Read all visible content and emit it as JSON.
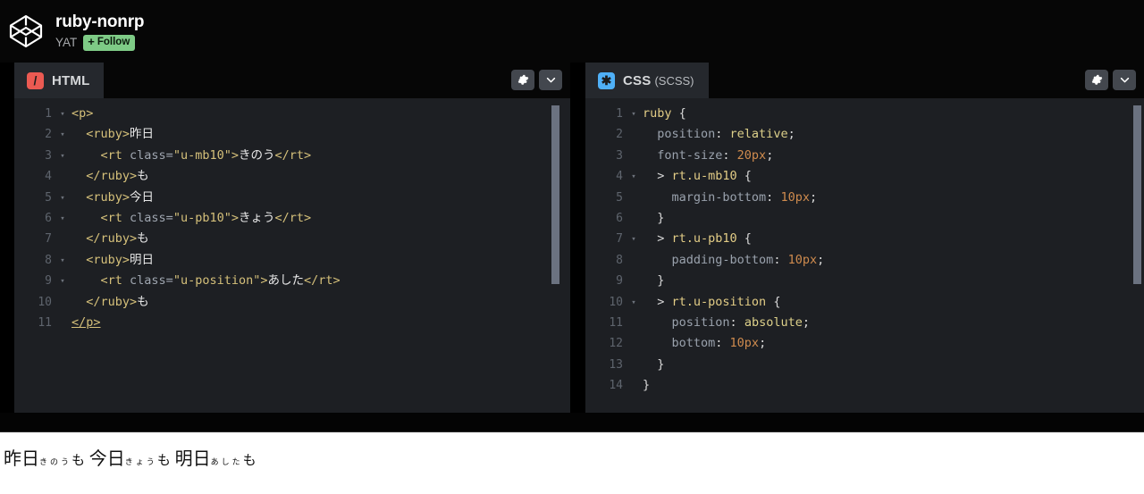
{
  "header": {
    "logo_icon": "codepen-logo-icon",
    "pen_title": "ruby-nonrp",
    "author": "YAT",
    "follow_plus": "+",
    "follow_label": "Follow"
  },
  "editors": {
    "html_pane": {
      "lang_icon": "html-slash-icon",
      "lang_icon_glyph": "/",
      "tab_label": "HTML",
      "settings_icon": "gear-icon",
      "collapse_icon": "chevron-down-icon",
      "lines": [
        {
          "n": "1",
          "fold": "▾",
          "segments": [
            {
              "c": "tag",
              "t": "<p>"
            }
          ]
        },
        {
          "n": "2",
          "fold": "▾",
          "segments": [
            {
              "c": "plain",
              "t": "  "
            },
            {
              "c": "tag",
              "t": "<ruby>"
            },
            {
              "c": "plain",
              "t": "昨日"
            }
          ]
        },
        {
          "n": "3",
          "fold": "▾",
          "segments": [
            {
              "c": "plain",
              "t": "    "
            },
            {
              "c": "tag",
              "t": "<rt "
            },
            {
              "c": "attr",
              "t": "class="
            },
            {
              "c": "str",
              "t": "\"u-mb10\""
            },
            {
              "c": "tag",
              "t": ">"
            },
            {
              "c": "plain",
              "t": "きのう"
            },
            {
              "c": "tag",
              "t": "</rt>"
            }
          ]
        },
        {
          "n": "4",
          "fold": "",
          "segments": [
            {
              "c": "plain",
              "t": "  "
            },
            {
              "c": "tag",
              "t": "</ruby>"
            },
            {
              "c": "plain",
              "t": "も"
            }
          ]
        },
        {
          "n": "5",
          "fold": "▾",
          "segments": [
            {
              "c": "plain",
              "t": "  "
            },
            {
              "c": "tag",
              "t": "<ruby>"
            },
            {
              "c": "plain",
              "t": "今日"
            }
          ]
        },
        {
          "n": "6",
          "fold": "▾",
          "segments": [
            {
              "c": "plain",
              "t": "    "
            },
            {
              "c": "tag",
              "t": "<rt "
            },
            {
              "c": "attr",
              "t": "class="
            },
            {
              "c": "str",
              "t": "\"u-pb10\""
            },
            {
              "c": "tag",
              "t": ">"
            },
            {
              "c": "plain",
              "t": "きょう"
            },
            {
              "c": "tag",
              "t": "</rt>"
            }
          ]
        },
        {
          "n": "7",
          "fold": "",
          "segments": [
            {
              "c": "plain",
              "t": "  "
            },
            {
              "c": "tag",
              "t": "</ruby>"
            },
            {
              "c": "plain",
              "t": "も"
            }
          ]
        },
        {
          "n": "8",
          "fold": "▾",
          "segments": [
            {
              "c": "plain",
              "t": "  "
            },
            {
              "c": "tag",
              "t": "<ruby>"
            },
            {
              "c": "plain",
              "t": "明日"
            }
          ]
        },
        {
          "n": "9",
          "fold": "▾",
          "segments": [
            {
              "c": "plain",
              "t": "    "
            },
            {
              "c": "tag",
              "t": "<rt "
            },
            {
              "c": "attr",
              "t": "class="
            },
            {
              "c": "str",
              "t": "\"u-position\""
            },
            {
              "c": "tag",
              "t": ">"
            },
            {
              "c": "plain",
              "t": "あした"
            },
            {
              "c": "tag",
              "t": "</rt>"
            }
          ]
        },
        {
          "n": "10",
          "fold": "",
          "segments": [
            {
              "c": "plain",
              "t": "  "
            },
            {
              "c": "tag",
              "t": "</ruby>"
            },
            {
              "c": "plain",
              "t": "も"
            }
          ]
        },
        {
          "n": "11",
          "fold": "",
          "segments": [
            {
              "c": "match",
              "t": "</p>"
            }
          ]
        }
      ]
    },
    "css_pane": {
      "lang_icon": "css-asterisk-icon",
      "lang_icon_glyph": "✱",
      "tab_label": "CSS",
      "tab_sublabel": "(SCSS)",
      "settings_icon": "gear-icon",
      "collapse_icon": "chevron-down-icon",
      "lines": [
        {
          "n": "1",
          "fold": "▾",
          "segments": [
            {
              "c": "sel",
              "t": "ruby"
            },
            {
              "c": "punc",
              "t": " {"
            }
          ]
        },
        {
          "n": "2",
          "fold": "",
          "segments": [
            {
              "c": "prop",
              "t": "  position"
            },
            {
              "c": "punc",
              "t": ": "
            },
            {
              "c": "val",
              "t": "relative"
            },
            {
              "c": "punc",
              "t": ";"
            }
          ]
        },
        {
          "n": "3",
          "fold": "",
          "segments": [
            {
              "c": "prop",
              "t": "  font-size"
            },
            {
              "c": "punc",
              "t": ": "
            },
            {
              "c": "num",
              "t": "20px"
            },
            {
              "c": "punc",
              "t": ";"
            }
          ]
        },
        {
          "n": "4",
          "fold": "▾",
          "segments": [
            {
              "c": "punc",
              "t": "  > "
            },
            {
              "c": "sel",
              "t": "rt.u-mb10"
            },
            {
              "c": "punc",
              "t": " {"
            }
          ]
        },
        {
          "n": "5",
          "fold": "",
          "segments": [
            {
              "c": "prop",
              "t": "    margin-bottom"
            },
            {
              "c": "punc",
              "t": ": "
            },
            {
              "c": "num",
              "t": "10px"
            },
            {
              "c": "punc",
              "t": ";"
            }
          ]
        },
        {
          "n": "6",
          "fold": "",
          "segments": [
            {
              "c": "punc",
              "t": "  }"
            }
          ]
        },
        {
          "n": "7",
          "fold": "▾",
          "segments": [
            {
              "c": "punc",
              "t": "  > "
            },
            {
              "c": "sel",
              "t": "rt.u-pb10"
            },
            {
              "c": "punc",
              "t": " {"
            }
          ]
        },
        {
          "n": "8",
          "fold": "",
          "segments": [
            {
              "c": "prop",
              "t": "    padding-bottom"
            },
            {
              "c": "punc",
              "t": ": "
            },
            {
              "c": "num",
              "t": "10px"
            },
            {
              "c": "punc",
              "t": ";"
            }
          ]
        },
        {
          "n": "9",
          "fold": "",
          "segments": [
            {
              "c": "punc",
              "t": "  }"
            }
          ]
        },
        {
          "n": "10",
          "fold": "▾",
          "segments": [
            {
              "c": "punc",
              "t": "  > "
            },
            {
              "c": "sel",
              "t": "rt.u-position"
            },
            {
              "c": "punc",
              "t": " {"
            }
          ]
        },
        {
          "n": "11",
          "fold": "",
          "segments": [
            {
              "c": "prop",
              "t": "    position"
            },
            {
              "c": "punc",
              "t": ": "
            },
            {
              "c": "val",
              "t": "absolute"
            },
            {
              "c": "punc",
              "t": ";"
            }
          ]
        },
        {
          "n": "12",
          "fold": "",
          "segments": [
            {
              "c": "prop",
              "t": "    bottom"
            },
            {
              "c": "punc",
              "t": ": "
            },
            {
              "c": "num",
              "t": "10px"
            },
            {
              "c": "punc",
              "t": ";"
            }
          ]
        },
        {
          "n": "13",
          "fold": "",
          "segments": [
            {
              "c": "punc",
              "t": "  }"
            }
          ]
        },
        {
          "n": "14",
          "fold": "",
          "segments": [
            {
              "c": "punc",
              "t": "}"
            }
          ]
        }
      ]
    }
  },
  "preview": {
    "groups": [
      {
        "base": "昨日",
        "ruby": "きのう",
        "cls": "u-mb10",
        "after": "も"
      },
      {
        "base": "今日",
        "ruby": "きょう",
        "cls": "u-pb10",
        "after": "も"
      },
      {
        "base": "明日",
        "ruby": "あした",
        "cls": "u-position",
        "after": "も"
      }
    ]
  },
  "colors": {
    "background": "#000000",
    "pane_bg": "#1d1f23",
    "pane_header": "#060606",
    "tab_bg": "#25282d",
    "follow_green": "#7ecb86",
    "html_accent": "#eb5a52",
    "css_accent": "#4fb0f7",
    "scrollbar": "#6b7280"
  }
}
